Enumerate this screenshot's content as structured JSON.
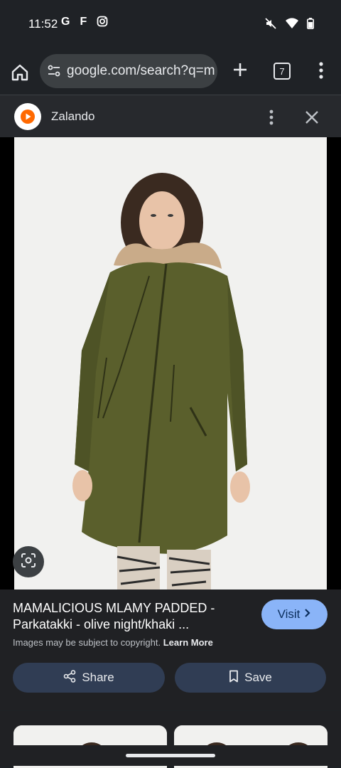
{
  "status_bar": {
    "time": "11:52",
    "left_icons": [
      "G",
      "F"
    ],
    "right_icons": [
      "mute-icon",
      "wifi-icon",
      "battery-icon"
    ]
  },
  "browser": {
    "url": "google.com/search?q=m",
    "tab_count": "7"
  },
  "site": {
    "name": "Zalando",
    "brand_color": "#ff6900"
  },
  "product": {
    "title": "MAMALICIOUS MLAMY PADDED - Parkatakki - olive night/khaki ...",
    "visit_label": "Visit",
    "copyright_text": "Images may be subject to copyright.",
    "learn_more": "Learn More",
    "share_label": "Share",
    "save_label": "Save"
  },
  "colors": {
    "accent": "#8ab4f8",
    "coat": "#5a5f2c",
    "pill": "#303d54"
  }
}
